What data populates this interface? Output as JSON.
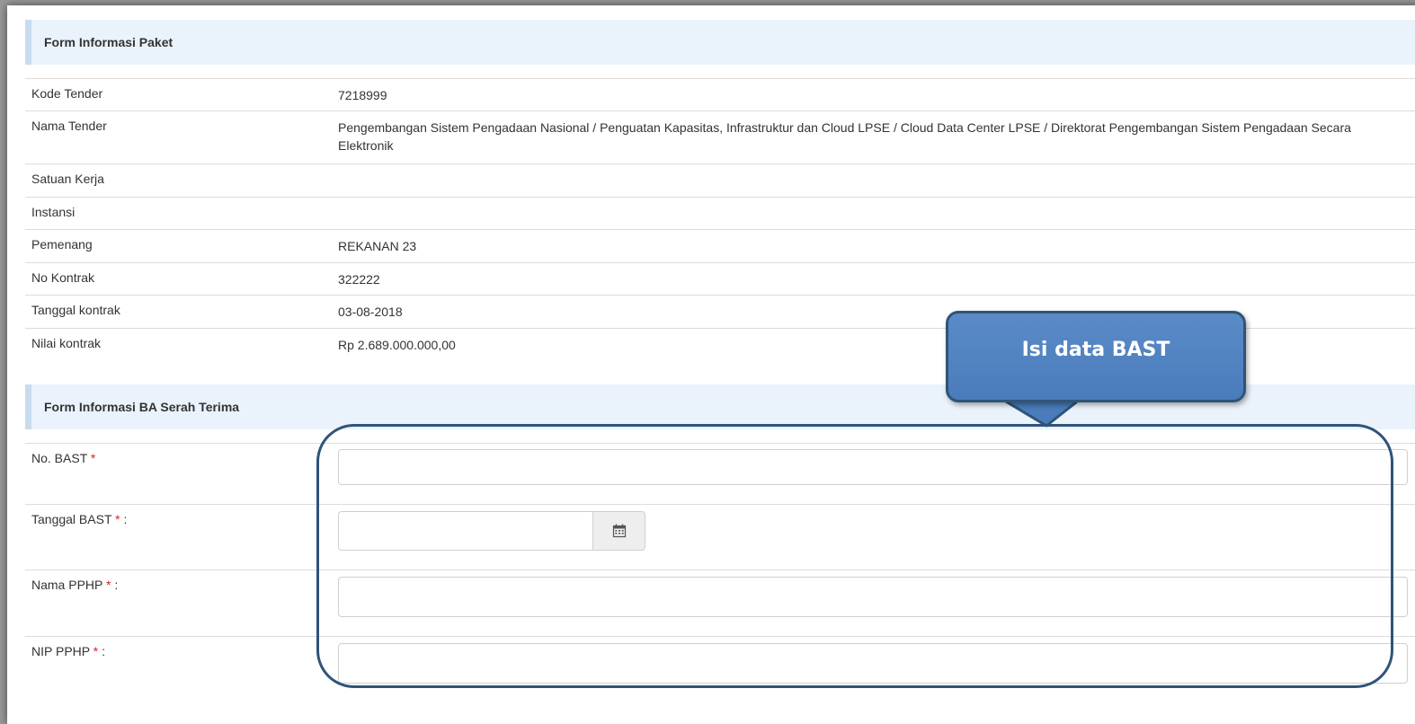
{
  "paket": {
    "heading": "Form Informasi Paket",
    "rows": [
      {
        "label": "Kode Tender",
        "value": "7218999"
      },
      {
        "label": "Nama Tender",
        "value": "Pengembangan Sistem Pengadaan Nasional / Penguatan Kapasitas, Infrastruktur dan Cloud LPSE / Cloud Data Center LPSE / Direktorat Pengembangan Sistem Pengadaan Secara Elektronik"
      },
      {
        "label": "Satuan Kerja",
        "value": ""
      },
      {
        "label": "Instansi",
        "value": ""
      },
      {
        "label": "Pemenang",
        "value": "REKANAN 23"
      },
      {
        "label": "No Kontrak",
        "value": "322222"
      },
      {
        "label": "Tanggal kontrak",
        "value": "03-08-2018"
      },
      {
        "label": "Nilai kontrak",
        "value": "Rp 2.689.000.000,00"
      }
    ]
  },
  "bast": {
    "heading": "Form Informasi BA Serah Terima",
    "required_mark": "*",
    "fields": [
      {
        "label": "No. BAST",
        "suffix": "",
        "value": ""
      },
      {
        "label": "Tanggal BAST",
        "suffix": " :",
        "value": ""
      },
      {
        "label": "Nama PPHP",
        "suffix": " :",
        "value": ""
      },
      {
        "label": "NIP PPHP",
        "suffix": " :",
        "value": ""
      }
    ],
    "calendar_icon": "calendar-icon"
  },
  "callout": {
    "text": "Isi data BAST"
  },
  "colors": {
    "callout_fill": "#4f81bd",
    "callout_border": "#2f5478",
    "heading_bg": "#eaf3fb",
    "required": "#e02020"
  }
}
